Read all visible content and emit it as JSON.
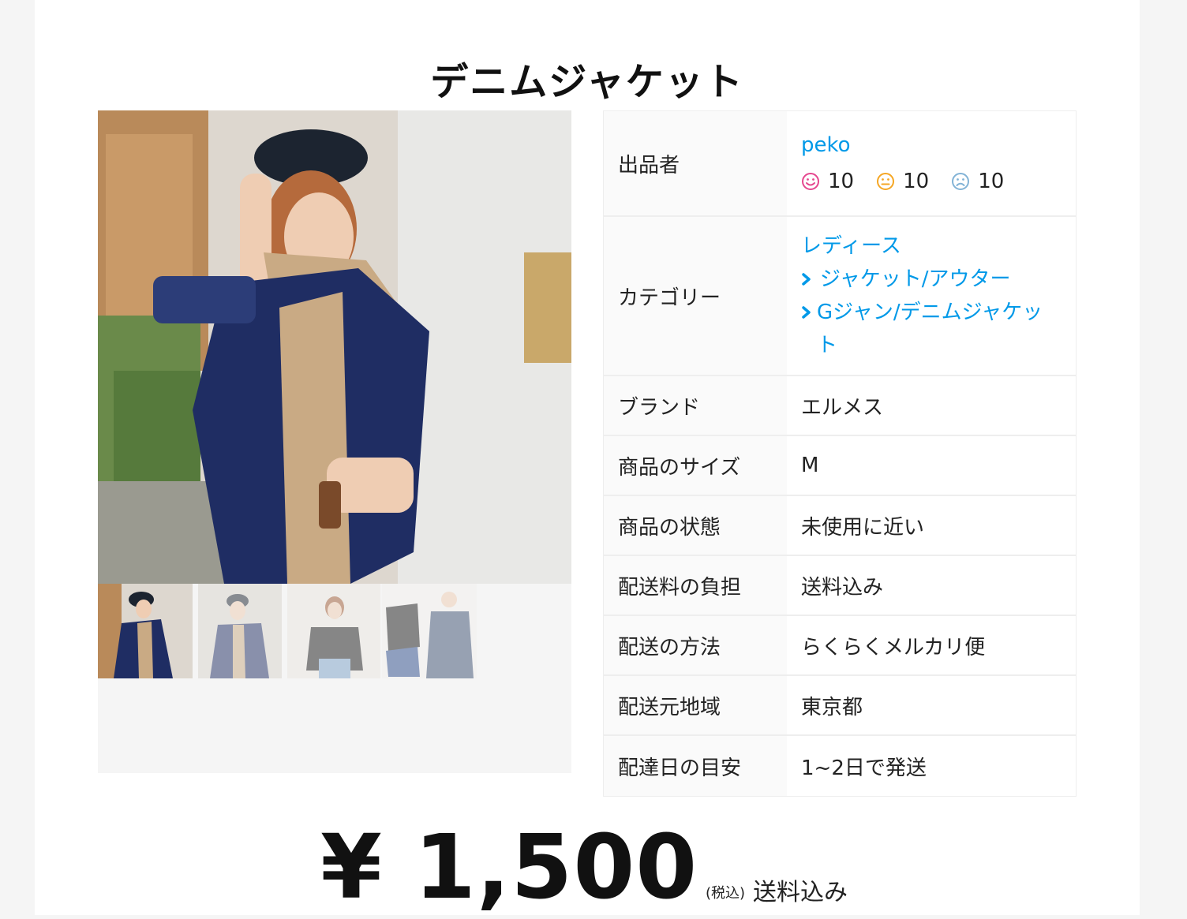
{
  "item": {
    "title": "デニムジャケット"
  },
  "gallery": {
    "main_image": "product-photo-denim-jacket",
    "thumbnails": [
      "thumb-1",
      "thumb-2",
      "thumb-3",
      "thumb-4",
      "thumb-5"
    ]
  },
  "details": {
    "seller_label": "出品者",
    "seller_name": "peko",
    "ratings": {
      "good": "10",
      "normal": "10",
      "bad": "10",
      "good_color": "#e5468f",
      "normal_color": "#f5a623",
      "bad_color": "#82b3d6"
    },
    "category_label": "カテゴリー",
    "category": [
      "レディース",
      "ジャケット/アウター",
      "Gジャン/デニムジャケット"
    ],
    "brand_label": "ブランド",
    "brand": "エルメス",
    "size_label": "商品のサイズ",
    "size": "M",
    "condition_label": "商品の状態",
    "condition": "未使用に近い",
    "shipping_fee_label": "配送料の負担",
    "shipping_fee": "送料込み",
    "shipping_method_label": "配送の方法",
    "shipping_method": "らくらくメルカリ便",
    "ship_from_label": "配送元地域",
    "ship_from": "東京都",
    "ship_days_label": "配達日の目安",
    "ship_days": "1~2日で発送"
  },
  "price": {
    "amount": "¥ 1,500",
    "tax_note": "(税込)",
    "shipping_note": "送料込み"
  },
  "colors": {
    "link": "#0099e8",
    "row_header_bg": "#fafafa",
    "border": "#eeeeee"
  }
}
